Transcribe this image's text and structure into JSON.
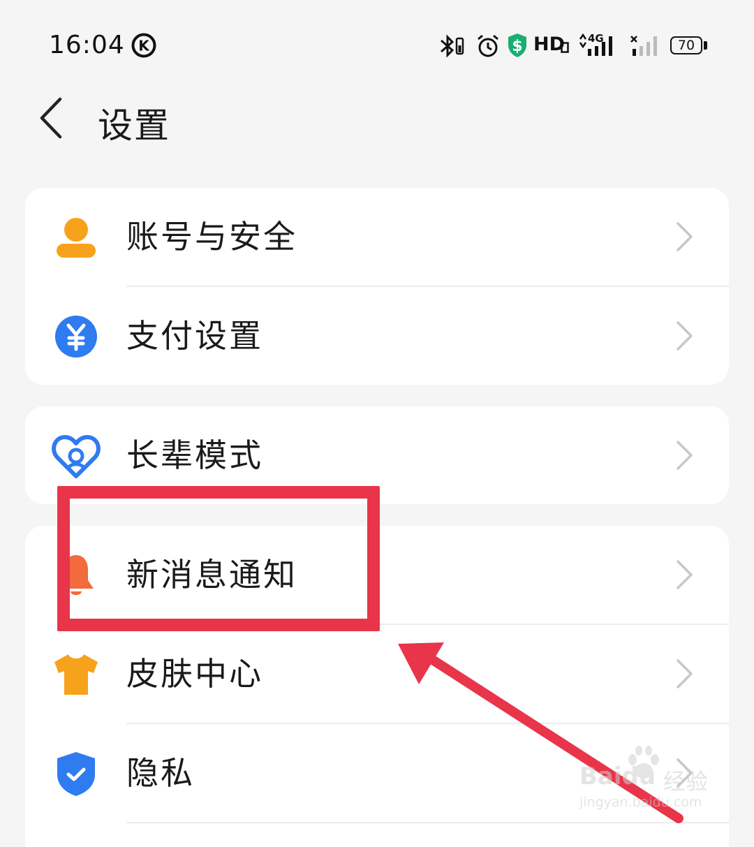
{
  "status_bar": {
    "time": "16:04",
    "k_badge": "K",
    "hd": "HD",
    "network": "4G",
    "battery": "70",
    "icons": [
      "bluetooth-icon",
      "alarm-icon",
      "shield-dollar-icon",
      "hd-icon",
      "signal-4g-icon",
      "signal-sim2-icon",
      "battery-icon"
    ]
  },
  "header": {
    "title": "设置",
    "back_icon": "chevron-left-icon"
  },
  "cards": [
    {
      "items": [
        {
          "label": "账号与安全",
          "icon": "person-icon",
          "color": "#f7a21b"
        },
        {
          "label": "支付设置",
          "icon": "yuan-icon",
          "color": "#2f7bf0"
        }
      ]
    },
    {
      "items": [
        {
          "label": "长辈模式",
          "icon": "heart-icon",
          "color": "#2f7bf0"
        }
      ]
    },
    {
      "items": [
        {
          "label": "新消息通知",
          "icon": "bell-icon",
          "color": "#f36a3c"
        },
        {
          "label": "皮肤中心",
          "icon": "tshirt-icon",
          "color": "#f7a21b"
        },
        {
          "label": "隐私",
          "icon": "shield-check-icon",
          "color": "#2f7bf0"
        }
      ]
    }
  ],
  "annotation": {
    "highlight_color": "#e8354a"
  },
  "watermark": {
    "brand": "Baidu",
    "suffix": "经验",
    "url": "jingyan.baidu.com"
  }
}
